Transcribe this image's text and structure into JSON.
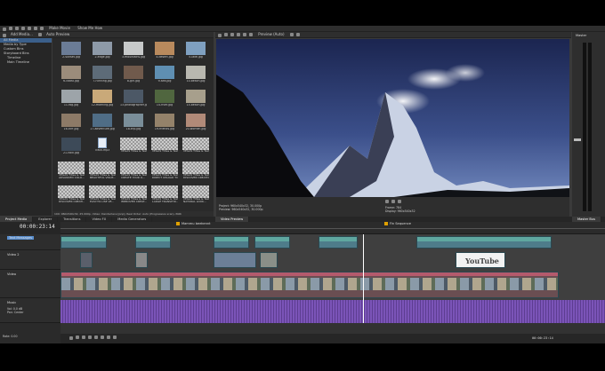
{
  "toolbar": {
    "make_movie": "Make Movie",
    "show_me_how": "Show Me How"
  },
  "explorer": {
    "add_media": "Add Media...",
    "auto_preview": "Auto Preview",
    "tree": [
      "All Media",
      "Media by Type",
      "Custom Bins",
      "Storyboard Bins",
      "Timeline",
      "Main Timeline"
    ],
    "status": "100: 960x540x32, 25.000p, Video: Deinterlace [pnp], Real Order: Auto (Progressive scan), PARi"
  },
  "media": [
    {
      "name": "2-sunset.jpg",
      "color": "#6b7c96"
    },
    {
      "name": "2-edge.jpg",
      "color": "#8e9aa8"
    },
    {
      "name": "3-mountains.jpg",
      "color": "#c7c9c9"
    },
    {
      "name": "4-desert.jpg",
      "color": "#b98a5d"
    },
    {
      "name": "5-lake.jpg",
      "color": "#7fa0c0"
    },
    {
      "name": "6-coast.jpg",
      "color": "#9b8c7b"
    },
    {
      "name": "7-running.jpg",
      "color": "#5d6b78"
    },
    {
      "name": "8-girl.jpg",
      "color": "#705a4c"
    },
    {
      "name": "9-sea.jpg",
      "color": "#5f8fb2"
    },
    {
      "name": "10-beach.jpg",
      "color": "#b9b8b0"
    },
    {
      "name": "11-fog.jpg",
      "color": "#9da4a9"
    },
    {
      "name": "12-morning.jpg",
      "color": "#c9a979"
    },
    {
      "name": "13-photographer.jpg",
      "color": "#4c5866"
    },
    {
      "name": "14-river.jpg",
      "color": "#50663f"
    },
    {
      "name": "15-beach.jpg",
      "color": "#a79f8c"
    },
    {
      "name": "16-cliff.jpg",
      "color": "#8d7a67"
    },
    {
      "name": "17-adventure.jpg",
      "color": "#4f6d86"
    },
    {
      "name": "18-trip.jpg",
      "color": "#7a8e99"
    },
    {
      "name": "19-friends.jpg",
      "color": "#94826a"
    },
    {
      "name": "20-women.jpg",
      "color": "#b18a78"
    },
    {
      "name": "21-rock.jpg",
      "color": "#3d4a58"
    },
    {
      "name": "Track.mp3",
      "color": "audio"
    },
    {
      "name": "VEGAS Titles & Text 41",
      "color": "checker"
    },
    {
      "name": "VEGAS Titles & Text 42",
      "color": "checker"
    },
    {
      "name": "VEGAS Titles & Text 43",
      "color": "checker"
    },
    {
      "name": "VEGAS Titles & Text\nADVANCED COLO...",
      "color": "checker"
    },
    {
      "name": "VEGAS Titles & Text\nBEAUTIFUL VISUE...",
      "color": "checker"
    },
    {
      "name": "VEGAS Titles & Text\nCREATE YOUR O...",
      "color": "checker"
    },
    {
      "name": "VEGAS Titles & Text\nDIRECT UPLOAD TO",
      "color": "checker"
    },
    {
      "name": "VEGAS Titles & Text\nDISCOVER CREATIV...",
      "color": "checker"
    },
    {
      "name": "VEGAS Titles & Text\nDISCOVER CREATI...",
      "color": "checker"
    },
    {
      "name": "VEGAS Titles & Text\nEASY-TO-USE VE...",
      "color": "checker"
    },
    {
      "name": "VEGAS Titles & Text\nIMPROVED CREAT...",
      "color": "checker"
    },
    {
      "name": "VEGAS Titles & Text\nLARGE TRANSITIO...",
      "color": "checker"
    },
    {
      "name": "VEGAS Titles & Text\nNATURAL LOOK...",
      "color": "checker"
    }
  ],
  "preview": {
    "label": "Preview (Auto)",
    "frame": "Frame:",
    "frame_value": "784",
    "display": "Display:",
    "display_value": "960x540x32",
    "project_info": "Project: 960x540x32, 30.000p",
    "preview_info": "Preview: 960x540x32, 30.000p"
  },
  "master": {
    "label": "Master",
    "bus": "Master Bus"
  },
  "tabs": [
    "Project Media",
    "Explorer",
    "Transitions",
    "Video FX",
    "Media Generators"
  ],
  "preview_tab": "Video Preview",
  "timeline": {
    "timecode": "00:00:23:14",
    "markers": [
      {
        "label": "Mammu beekennt"
      },
      {
        "label": "Fin Sequence"
      }
    ],
    "tracks": [
      {
        "name": "Text Messages",
        "level": ""
      },
      {
        "name": "Video 2",
        "level": ""
      },
      {
        "name": "Video",
        "level": ""
      },
      {
        "name": "Music",
        "level": "Vol: 0.0 dB\nPan: Center"
      }
    ],
    "rate_label": "Rate: 0.00",
    "end_time": "00:00:23:14",
    "youtube_text": "YouTube"
  },
  "colors": {
    "accent": "#5fa7a0",
    "audio": "#7b54b8",
    "selection": "#3b5f8a"
  }
}
